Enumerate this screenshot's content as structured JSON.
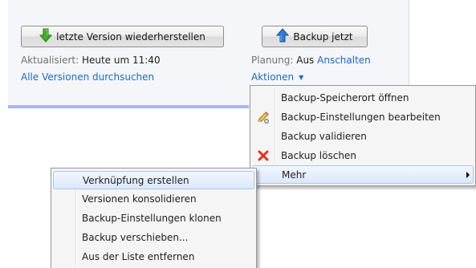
{
  "panel": {
    "restore_button_label": "letzte Version wiederherstellen",
    "backup_now_button_label": "Backup jetzt",
    "updated_label": "Aktualisiert:",
    "updated_value": "Heute um 11:40",
    "browse_versions_link": "Alle Versionen durchsuchen",
    "schedule_label": "Planung:",
    "schedule_value": "Aus",
    "schedule_enable_link": "Anschalten",
    "actions_link": "Aktionen"
  },
  "actions_menu": {
    "items": [
      {
        "label": "Backup-Speicherort öffnen",
        "icon": "none"
      },
      {
        "label": "Backup-Einstellungen bearbeiten",
        "icon": "edit-pencil-icon"
      },
      {
        "label": "Backup validieren",
        "icon": "none"
      },
      {
        "label": "Backup löschen",
        "icon": "delete-x-icon"
      },
      {
        "label": "Mehr",
        "icon": "none",
        "has_submenu": true,
        "highlighted": true
      }
    ]
  },
  "more_menu": {
    "items": [
      {
        "label": "Verknüpfung erstellen",
        "highlighted": true
      },
      {
        "label": "Versionen konsolidieren"
      },
      {
        "label": "Backup-Einstellungen klonen"
      },
      {
        "label": "Backup verschieben..."
      },
      {
        "label": "Aus der Liste entfernen"
      }
    ]
  },
  "colors": {
    "link": "#1b6ac9",
    "panel_background": "#f4f6f9",
    "panel_accent": "#a7b6ec",
    "menu_highlight_border": "#a9c6ea",
    "delete_icon": "#e2321e"
  }
}
